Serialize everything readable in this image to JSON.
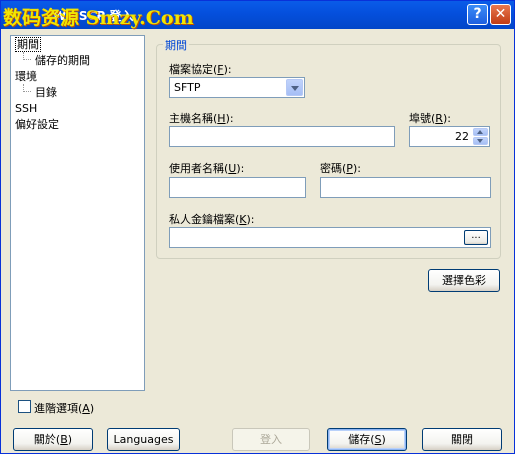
{
  "window": {
    "title": "WinSCP 登入",
    "watermark": "数码资源 Smzy.Com",
    "help_glyph": "?",
    "close_glyph": "✕"
  },
  "tree": {
    "items": [
      {
        "label": "期間",
        "level": 0,
        "selected": true
      },
      {
        "label": "儲存的期間",
        "level": 1
      },
      {
        "label": "環境",
        "level": 0
      },
      {
        "label": "目錄",
        "level": 1
      },
      {
        "label": "SSH",
        "level": 0
      },
      {
        "label": "偏好設定",
        "level": 0
      }
    ]
  },
  "session": {
    "group_title": "期間",
    "protocol_label": "檔案協定(",
    "protocol_key": "F",
    "protocol_suffix": "):",
    "protocol_value": "SFTP",
    "host_label": "主機名稱(",
    "host_key": "H",
    "host_suffix": "):",
    "host_value": "",
    "port_label": "埠號(",
    "port_key": "R",
    "port_suffix": "):",
    "port_value": "22",
    "user_label": "使用者名稱(",
    "user_key": "U",
    "user_suffix": "):",
    "user_value": "",
    "password_label": "密碼(",
    "password_key": "P",
    "password_suffix": "):",
    "password_value": "",
    "key_label": "私人金鑰檔案(",
    "key_key": "K",
    "key_suffix": "):",
    "key_value": "",
    "browse_label": "...",
    "color_button": "選擇色彩"
  },
  "footer": {
    "advanced_label": "進階選項(",
    "advanced_key": "A",
    "advanced_suffix": ")",
    "advanced_checked": false,
    "about_label": "關於(",
    "about_key": "B",
    "about_suffix": ")",
    "languages_label": "Languages",
    "login_label": "登入",
    "save_label": "儲存(",
    "save_key": "S",
    "save_suffix": ")",
    "close_label": "關閉"
  }
}
